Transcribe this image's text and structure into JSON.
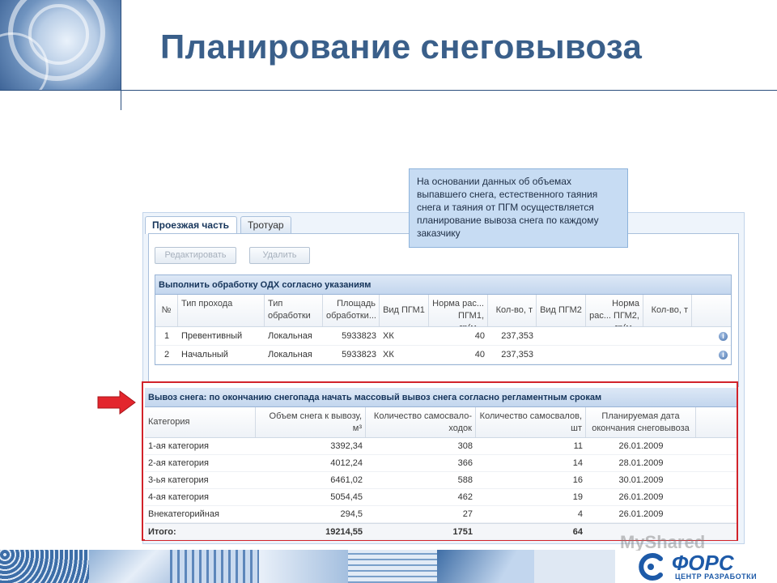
{
  "slide": {
    "title": "Планирование снеговывоза",
    "callout": "На основании данных об объемах выпавшего снега, естественного таяния снега и таяния от ПГМ осуществляется планирование вывоза снега по каждому заказчику"
  },
  "tabs": [
    {
      "label": "Проезжая часть",
      "active": true
    },
    {
      "label": "Тротуар",
      "active": false
    }
  ],
  "toolbar": {
    "edit_label": "Редактировать",
    "delete_label": "Удалить"
  },
  "grid1": {
    "title": "Выполнить обработку ОДХ согласно указаниям",
    "headers": [
      "№",
      "Тип прохода",
      "Тип обработки",
      "Площадь обработки...",
      "Вид ПГМ1",
      "Норма рас... ПГМ1, гр(м...",
      "Кол-во, т",
      "Вид ПГМ2",
      "Норма рас... ПГМ2, гр(м...",
      "Кол-во, т"
    ],
    "rows": [
      {
        "n": "1",
        "type": "Превентивный",
        "proc": "Локальная",
        "area": "5933823",
        "pgm1": "ХК",
        "norm1": "40",
        "qty1": "237,353",
        "pgm2": "",
        "norm2": "",
        "qty2": ""
      },
      {
        "n": "2",
        "type": "Начальный",
        "proc": "Локальная",
        "area": "5933823",
        "pgm1": "ХК",
        "norm1": "40",
        "qty1": "237,353",
        "pgm2": "",
        "norm2": "",
        "qty2": ""
      }
    ]
  },
  "grid2": {
    "title": "Вывоз снега: по окончанию снегопада начать массовый вывоз снега согласно регламентным срокам",
    "headers": [
      "Категория",
      "Объем снега к вывозу, м³",
      "Количество самосвало-ходок",
      "Количество самосвалов, шт",
      "Планируемая дата окончания снеговывоза"
    ],
    "rows": [
      {
        "cat": "1-ая категория",
        "vol": "3392,34",
        "trips": "308",
        "trucks": "11",
        "date": "26.01.2009"
      },
      {
        "cat": "2-ая категория",
        "vol": "4012,24",
        "trips": "366",
        "trucks": "14",
        "date": "28.01.2009"
      },
      {
        "cat": "3-ья категория",
        "vol": "6461,02",
        "trips": "588",
        "trucks": "16",
        "date": "30.01.2009"
      },
      {
        "cat": "4-ая категория",
        "vol": "5054,45",
        "trips": "462",
        "trucks": "19",
        "date": "26.01.2009"
      },
      {
        "cat": "Внекатегорийная",
        "vol": "294,5",
        "trips": "27",
        "trucks": "4",
        "date": "26.01.2009"
      }
    ],
    "total": {
      "label": "Итого:",
      "vol": "19214,55",
      "trips": "1751",
      "trucks": "64"
    }
  },
  "logo": {
    "name": "ФОРС",
    "subtitle": "ЦЕНТР РАЗРАБОТКИ"
  },
  "watermark": "MyShared",
  "colors": {
    "title": "#3a5f8a",
    "accent_red": "#d2232a",
    "logo_blue": "#1d5aa8"
  }
}
